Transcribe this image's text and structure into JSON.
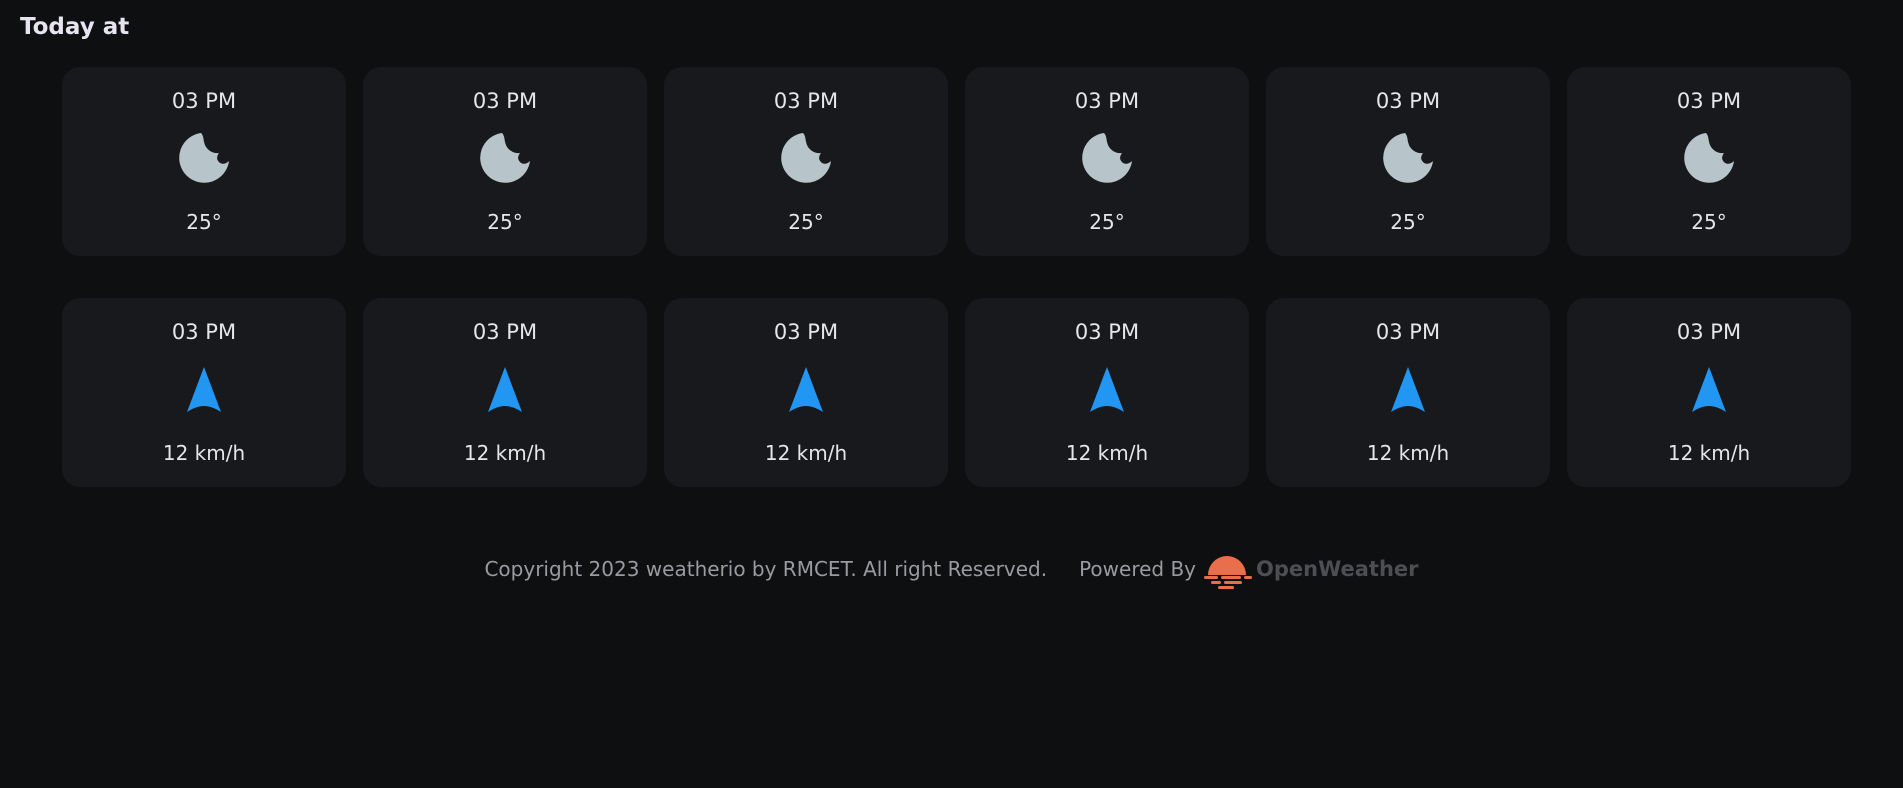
{
  "section": {
    "title": "Today at"
  },
  "temperature_cards": [
    {
      "time": "03 PM",
      "icon": "moon-icon",
      "value": "25°"
    },
    {
      "time": "03 PM",
      "icon": "moon-icon",
      "value": "25°"
    },
    {
      "time": "03 PM",
      "icon": "moon-icon",
      "value": "25°"
    },
    {
      "time": "03 PM",
      "icon": "moon-icon",
      "value": "25°"
    },
    {
      "time": "03 PM",
      "icon": "moon-icon",
      "value": "25°"
    },
    {
      "time": "03 PM",
      "icon": "moon-icon",
      "value": "25°"
    }
  ],
  "wind_cards": [
    {
      "time": "03 PM",
      "icon": "wind-direction-arrow-icon",
      "value": "12 km/h"
    },
    {
      "time": "03 PM",
      "icon": "wind-direction-arrow-icon",
      "value": "12 km/h"
    },
    {
      "time": "03 PM",
      "icon": "wind-direction-arrow-icon",
      "value": "12 km/h"
    },
    {
      "time": "03 PM",
      "icon": "wind-direction-arrow-icon",
      "value": "12 km/h"
    },
    {
      "time": "03 PM",
      "icon": "wind-direction-arrow-icon",
      "value": "12 km/h"
    },
    {
      "time": "03 PM",
      "icon": "wind-direction-arrow-icon",
      "value": "12 km/h"
    }
  ],
  "footer": {
    "copyright": "Copyright 2023 weatherio by RMCET. All right Reserved.",
    "powered_by": "Powered By",
    "brand_name": "OpenWeather",
    "brand_icon": "openweather-logo-icon"
  },
  "colors": {
    "background": "#0e0f11",
    "card": "#18191c",
    "moon": "#b7c4ca",
    "wind_arrow": "#2196f3",
    "brand_orange": "#eb6e4b"
  }
}
